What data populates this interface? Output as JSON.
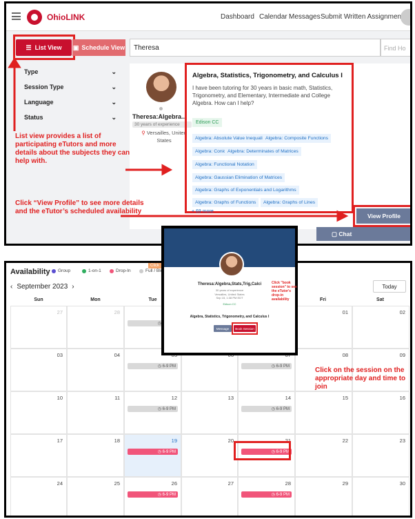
{
  "nav": {
    "brand": "OhioLINK",
    "links": [
      "Dashboard",
      "Calendar",
      "Messages",
      "Submit Written Assignments"
    ]
  },
  "view": {
    "list": "List View",
    "schedule": "Schedule View"
  },
  "search": {
    "value": "Theresa",
    "placeholder": "Find Ho"
  },
  "filters": [
    "Type",
    "Session Type",
    "Language",
    "Status"
  ],
  "tutor": {
    "name": "Theresa:Algebra...",
    "years": "30 years of experience",
    "location": "Versailles, United States"
  },
  "subject": {
    "title": "Algebra, Statistics, Trigonometry, and Calculus I",
    "desc": "I have been tutoring for 30 years in basic math, Statistics, Trigonometry, and Elementary, Intermediate and College Algebra. How can I help?",
    "school": "Edison CC",
    "tags": [
      "Algebra: Absolute Value Inequalities",
      "Algebra: Composite Functions",
      "Algebra: Conics",
      "Algebra: Determinates of Matrices",
      "Algebra: Functional Notation",
      "Algebra: Gaussian Elimination of Matrices",
      "Algebra: Graphs of Exponentials and Logarithms",
      "Algebra: Graphs of Functions",
      "Algebra: Graphs of Lines"
    ],
    "more": "+ 69 more"
  },
  "buttons": {
    "view_profile": "View Profile",
    "chat": "Chat"
  },
  "annotations": {
    "list": "List view provides a list of participating eTutors and more details about the subjects they can help with.",
    "profile": "Click “View Profile” to see more details and the eTutor’s scheduled availability",
    "book": "Click \"book session\" to see the eTutor's drop-in availability",
    "click": "Click on the session on the appropriate day and time to join"
  },
  "calendar": {
    "availability": "Availability",
    "legend": [
      {
        "label": "Group",
        "color": "#5b4fd1"
      },
      {
        "label": "1-on-1",
        "color": "#2fae5f"
      },
      {
        "label": "Drop-In",
        "color": "#f1557a"
      },
      {
        "label": "Full / Bloc",
        "color": "#cccccc"
      }
    ],
    "month": "September 2023",
    "today": "Today",
    "hidden_label": "Click",
    "days": [
      "Sun",
      "Mon",
      "Tue",
      "",
      "Thu",
      "Fri",
      "Sat"
    ],
    "weeks": [
      [
        "27",
        "28",
        "",
        "",
        "",
        "01",
        "02"
      ],
      [
        "03",
        "04",
        "05",
        "06",
        "07",
        "08",
        "09"
      ],
      [
        "10",
        "11",
        "12",
        "13",
        "14",
        "15",
        "16"
      ],
      [
        "17",
        "18",
        "19",
        "20",
        "21",
        "22",
        "23"
      ],
      [
        "24",
        "25",
        "26",
        "27",
        "28",
        "29",
        "30"
      ]
    ],
    "event": "6-9 PM"
  },
  "modal": {
    "name": "Theresa:Algebra,Stats,Trig,Calci",
    "years": "30 years of experience",
    "location": "Versailles, United States",
    "time": "Sep 15, 1:38 PM EDT",
    "school": "Edison CC",
    "subject": "Algebra, Statistics, Trigonometry, and Calculus I",
    "message": "Message",
    "book": "Book Session"
  }
}
